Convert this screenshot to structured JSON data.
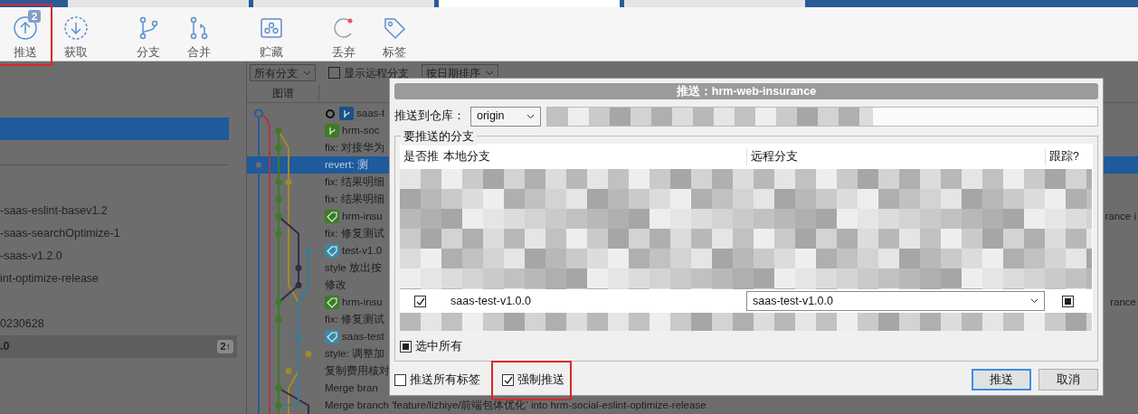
{
  "tabs": [
    {
      "selected": false
    },
    {
      "selected": false
    },
    {
      "selected": true
    },
    {
      "selected": false
    }
  ],
  "toolbar": [
    {
      "kind": "push",
      "label": "推送",
      "badge": "2",
      "highlighted": true
    },
    {
      "kind": "fetch",
      "label": "获取",
      "highlighted": false
    },
    {
      "kind": "branch",
      "label": "分支",
      "highlighted": false
    },
    {
      "kind": "merge",
      "label": "合并",
      "highlighted": false
    },
    {
      "kind": "stash",
      "label": "贮藏",
      "highlighted": false
    },
    {
      "kind": "discard",
      "label": "丢弃",
      "highlighted": false
    },
    {
      "kind": "tag",
      "label": "标签",
      "highlighted": false
    }
  ],
  "sidebar": {
    "groups": [
      [
        {
          "selected": true
        }
      ],
      [
        {
          "label": "-saas-eslint-basev1.2",
          "selected": false,
          "current": false
        },
        {
          "label": "-saas-searchOptimize-1",
          "selected": false,
          "current": false
        },
        {
          "label": "-saas-v1.2.0",
          "selected": false,
          "current": false
        },
        {
          "label": "int-optimize-release",
          "selected": false,
          "current": false
        }
      ],
      [
        {
          "label": "0230628",
          "selected": false,
          "current": false
        },
        {
          "label": ".0",
          "selected": false,
          "current": true,
          "badge": "2↑"
        }
      ]
    ]
  },
  "filters": {
    "branch_select": "所有分支",
    "show_remote": {
      "label": "显示远程分支",
      "checked": false
    },
    "sort_select": "按日期排序"
  },
  "graph_header": "图谱",
  "commits": [
    {
      "text": "saas-t",
      "kind": "branch",
      "color": "#1e4f86",
      "head": true,
      "selected": false
    },
    {
      "text": "hrm-soc",
      "kind": "branch",
      "color": "#3f7a24",
      "selected": false
    },
    {
      "text": "fix: 对接华为",
      "selected": false
    },
    {
      "text": "revert:  测",
      "selected": true
    },
    {
      "text": "fix: 结果明细",
      "selected": false
    },
    {
      "text": "fix: 结果明细",
      "selected": false
    },
    {
      "text": "hrm-insu",
      "kind": "tag",
      "color": "#3f7a24",
      "tail": "rance i",
      "selected": false
    },
    {
      "text": "fix: 修复测试",
      "selected": false
    },
    {
      "text": "test-v1.0",
      "kind": "tag",
      "color": "#3f86a8",
      "selected": false
    },
    {
      "text": "style 放出按",
      "selected": false
    },
    {
      "text": "修改",
      "selected": false
    },
    {
      "text": "hrm-insu",
      "kind": "tag",
      "color": "#3f7a24",
      "tail": "rance",
      "selected": false
    },
    {
      "text": "fix: 修复测试",
      "selected": false
    },
    {
      "text": "saas-test",
      "kind": "tag",
      "color": "#3f86a8",
      "selected": false
    },
    {
      "text": "style: 调整加",
      "selected": false
    },
    {
      "text": "复制费用核对",
      "selected": false
    },
    {
      "text": "Merge bran",
      "selected": false
    },
    {
      "text": "Merge branch 'feature/lizhiye/前端包体优化' into hrm-social-eslint-optimize-release",
      "selected": false
    }
  ],
  "push_dialog": {
    "title": "推送：hrm-web-insurance",
    "repo_label": "推送到仓库：",
    "repo_select": "origin",
    "branches_legend": "要推送的分支",
    "columns": [
      "是否推",
      "本地分支",
      "远程分支",
      "跟踪?"
    ],
    "rows": [
      {
        "push": true,
        "local": "saas-test-v1.0.0",
        "remote": "saas-test-v1.0.0",
        "track": true
      }
    ],
    "select_all": {
      "label": "选中所有",
      "checked": true
    },
    "options": [
      {
        "label": "推送所有标签",
        "checked": false,
        "highlighted": false
      },
      {
        "label": "强制推送",
        "checked": true,
        "highlighted": true
      }
    ],
    "buttons": [
      {
        "label": "推送",
        "default": true
      },
      {
        "label": "取消",
        "default": false
      }
    ]
  }
}
